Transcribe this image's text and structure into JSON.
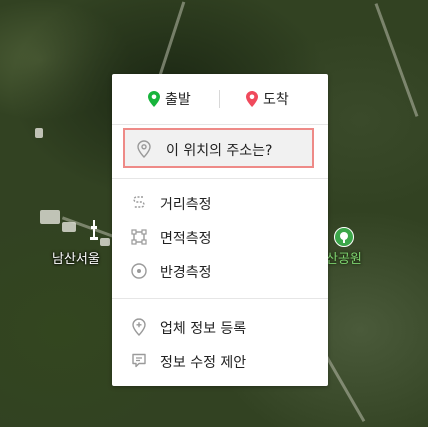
{
  "map": {
    "label_namsan_tower": "남산서울",
    "label_park": "산공원"
  },
  "context_menu": {
    "origin_label": "출발",
    "destination_label": "도착",
    "address_query_label": "이 위치의 주소는?",
    "tools": [
      {
        "label": "거리측정",
        "icon": "distance-icon"
      },
      {
        "label": "면적측정",
        "icon": "area-icon"
      },
      {
        "label": "반경측정",
        "icon": "radius-icon"
      }
    ],
    "actions": [
      {
        "label": "업체 정보 등록",
        "icon": "add-place-icon"
      },
      {
        "label": "정보 수정 제안",
        "icon": "suggest-edit-icon"
      }
    ],
    "colors": {
      "origin_pin": "#18b43c",
      "destination_pin": "#f04a5c",
      "highlight_border": "#ee8a87"
    }
  }
}
